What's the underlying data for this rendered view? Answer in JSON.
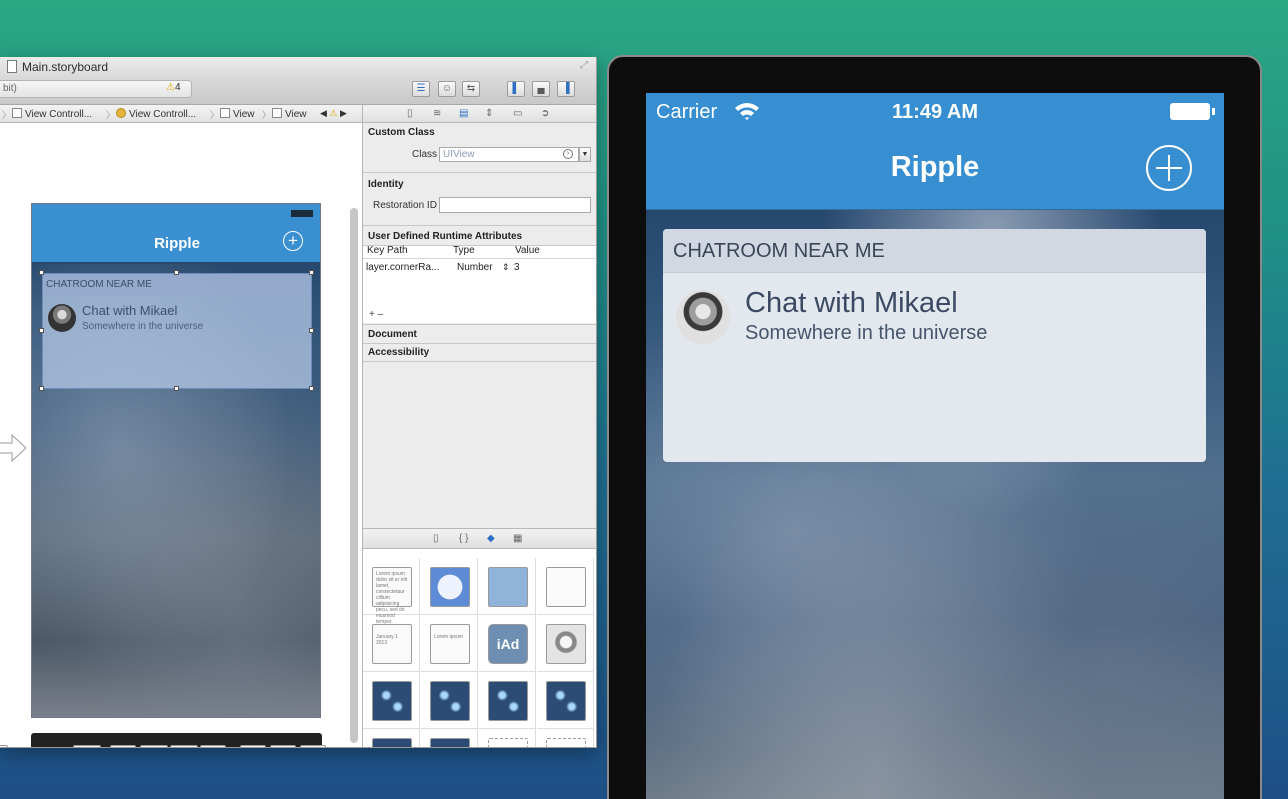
{
  "xcode": {
    "window_title": "Main.storyboard",
    "status_text": "bit)",
    "warning_count": "4",
    "jumpbar": [
      "View Controll...",
      "View Controll...",
      "View",
      "View"
    ],
    "canvas_phone": {
      "nav_title": "Ripple",
      "header": "CHATROOM NEAR ME",
      "chat_title": "Chat with Mikael",
      "chat_subtitle": "Somewhere in the universe"
    }
  },
  "inspector": {
    "custom_class": {
      "heading": "Custom Class",
      "class_label": "Class",
      "class_placeholder": "UIView"
    },
    "identity": {
      "heading": "Identity",
      "restoration_label": "Restoration ID"
    },
    "runtime_attrs": {
      "heading": "User Defined Runtime Attributes",
      "columns": [
        "Key Path",
        "Type",
        "Value"
      ],
      "row": {
        "key_path": "layer.cornerRa...",
        "type": "Number",
        "value": "3"
      },
      "add_remove": "+  –"
    },
    "document": {
      "heading": "Document"
    },
    "accessibility": {
      "heading": "Accessibility"
    }
  },
  "library": {
    "tiles": [
      "text-view",
      "web-view",
      "map-view",
      "view",
      "date-picker",
      "picker-view",
      "ad-banner",
      "glkit-view",
      "tap-gesture",
      "pinch-gesture",
      "rotation-gesture",
      "swipe-gesture",
      "pan-gesture",
      "long-press-gesture",
      "custom-gesture",
      "object"
    ],
    "textview_sample": "Lorem ipsum dolor sit er elit lamet, consectetaur cillium adipisicing pecu, sed do eiusmod tempor. Quisque in tellus.",
    "datepicker_sample": "January  1  2013",
    "picker_sample": "Lorem ipsum",
    "ad_label": "iAd"
  },
  "simulator": {
    "status": {
      "carrier": "Carrier",
      "time": "11:49 AM"
    },
    "nav_title": "Ripple",
    "card": {
      "header": "CHATROOM NEAR ME",
      "title": "Chat with Mikael",
      "subtitle": "Somewhere in the universe"
    }
  }
}
